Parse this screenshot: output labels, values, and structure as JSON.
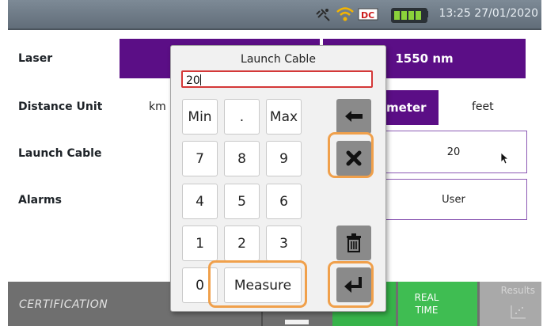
{
  "status_bar": {
    "time": "13:25",
    "date": "27/01/2020",
    "icons": [
      "satellite-icon",
      "wifi-icon",
      "dc-power-icon",
      "battery-icon"
    ],
    "dc_label": "DC"
  },
  "settings": {
    "laser": {
      "label": "Laser",
      "value": "1550 nm"
    },
    "distance_unit": {
      "label": "Distance Unit",
      "options": [
        "km",
        "meter",
        "feet"
      ],
      "selected": "meter",
      "selected_visible_text": "meter"
    },
    "launch_cable": {
      "label": "Launch Cable",
      "value": "20"
    },
    "alarms": {
      "label": "Alarms",
      "value": "User"
    }
  },
  "keypad": {
    "title": "Launch Cable",
    "input_value": "20",
    "keys": {
      "min": "Min",
      "dot": ".",
      "max": "Max",
      "k7": "7",
      "k8": "8",
      "k9": "9",
      "k4": "4",
      "k5": "5",
      "k6": "6",
      "k1": "1",
      "k2": "2",
      "k3": "3",
      "k0": "0",
      "measure": "Measure"
    },
    "icons": [
      "backspace-icon",
      "clear-icon",
      "trash-icon",
      "enter-icon"
    ]
  },
  "bottom_bar": {
    "mode": "CERTIFICATION",
    "real_time_line1": "REAL",
    "real_time_line2": "TIME",
    "results": "Results"
  },
  "colors": {
    "accent_purple": "#5b0e86",
    "status_bar": "#6a7682",
    "green": "#37b34a",
    "highlight_orange": "#f0a04b",
    "input_border_red": "#d43838"
  }
}
